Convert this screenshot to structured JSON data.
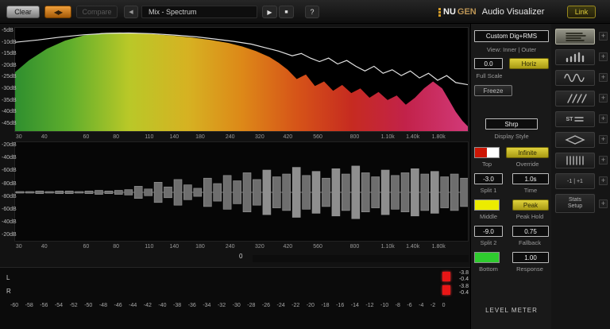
{
  "toolbar": {
    "clear": "Clear",
    "swap_icon": "◀▶",
    "compare": "Compare",
    "prev_icon": "◀",
    "preset": "Mix - Spectrum",
    "play_icon": "▶",
    "stop_icon": "■",
    "help": "?",
    "brand_nu": "NU",
    "brand_gen": "GEN",
    "brand_rest": "Audio Visualizer",
    "link": "Link"
  },
  "panel": {
    "mode": "Custom Dig+RMS",
    "view_label": "View: Inner | Outer",
    "full_scale_value": "0.0",
    "horiz": "Horiz",
    "full_scale_label": "Full Scale",
    "freeze": "Freeze",
    "display_style_value": "Shrp",
    "display_style_label": "Display Style",
    "top_label": "Top",
    "override_value": "Infinite",
    "override_label": "Override",
    "split1_value": "-3.0",
    "split1_label": "Split 1",
    "time_value": "1.0s",
    "time_label": "Time",
    "middle_label": "Middle",
    "peak_value": "Peak",
    "peak_hold_label": "Peak Hold",
    "split2_value": "-9.0",
    "split2_label": "Split 2",
    "fallback_value": "0.75",
    "fallback_label": "Fallback",
    "bottom_label": "Bottom",
    "response_value": "1.00",
    "response_label": "Response",
    "level_meter_label": "LEVEL METER",
    "colors": {
      "top_left": "#cc1605",
      "top_right": "#ffffff",
      "middle": "#ecec00",
      "bottom": "#2fcc2f",
      "accent_yellow": "#d8c623"
    }
  },
  "sidebar": {
    "plus": "+",
    "items": [
      {
        "name": "spectrum-lines",
        "selected": true
      },
      {
        "name": "bar-graph",
        "selected": false
      },
      {
        "name": "waveform",
        "selected": false
      },
      {
        "name": "diagonal-lines",
        "selected": false
      },
      {
        "name": "stereo",
        "selected": false,
        "label": "ST"
      },
      {
        "name": "vectorscope",
        "selected": false
      },
      {
        "name": "vertical-bars",
        "selected": false
      },
      {
        "name": "channel-select",
        "selected": false,
        "label": "-1 | +1"
      },
      {
        "name": "stats-setup",
        "selected": false,
        "label_1": "Stats",
        "label_2": "Setup"
      }
    ]
  },
  "width_meter": {
    "zero_label": "0",
    "segments": 54,
    "lit": 54,
    "color": "#2ed22e"
  },
  "chart_data": [
    {
      "type": "area",
      "title": "Main spectrum display (Mix - Spectrum)",
      "ylabel": "dB",
      "ylim": [
        -48,
        -3
      ],
      "grid": false,
      "y_ticks": [
        "-5dB",
        "-10dB",
        "-15dB",
        "-20dB",
        "-25dB",
        "-30dB",
        "-35dB",
        "-40dB",
        "-45dB"
      ],
      "x_ticks": [
        {
          "label": "30",
          "pos": 0.01
        },
        {
          "label": "40",
          "pos": 0.066
        },
        {
          "label": "60",
          "pos": 0.158
        },
        {
          "label": "80",
          "pos": 0.224
        },
        {
          "label": "110",
          "pos": 0.297
        },
        {
          "label": "140",
          "pos": 0.352
        },
        {
          "label": "180",
          "pos": 0.409
        },
        {
          "label": "240",
          "pos": 0.475
        },
        {
          "label": "320",
          "pos": 0.54
        },
        {
          "label": "420",
          "pos": 0.602
        },
        {
          "label": "560",
          "pos": 0.668
        },
        {
          "label": "800",
          "pos": 0.749
        },
        {
          "label": "1.10k",
          "pos": 0.822
        },
        {
          "label": "1.40k",
          "pos": 0.877
        },
        {
          "label": "1.80k",
          "pos": 0.934
        }
      ],
      "series": [
        {
          "name": "spectrum-fill",
          "points": [
            [
              0,
              -22
            ],
            [
              0.03,
              -17
            ],
            [
              0.07,
              -12
            ],
            [
              0.11,
              -8.5
            ],
            [
              0.15,
              -6.3
            ],
            [
              0.19,
              -5.2
            ],
            [
              0.23,
              -5
            ],
            [
              0.27,
              -5.2
            ],
            [
              0.31,
              -5.8
            ],
            [
              0.35,
              -6.4
            ],
            [
              0.39,
              -7.2
            ],
            [
              0.43,
              -8.2
            ],
            [
              0.47,
              -9.5
            ],
            [
              0.5,
              -11
            ],
            [
              0.53,
              -13
            ],
            [
              0.56,
              -15.5
            ],
            [
              0.58,
              -18
            ],
            [
              0.6,
              -21
            ],
            [
              0.62,
              -25
            ],
            [
              0.64,
              -23
            ],
            [
              0.66,
              -28
            ],
            [
              0.68,
              -26
            ],
            [
              0.7,
              -30
            ],
            [
              0.72,
              -27.5
            ],
            [
              0.74,
              -31
            ],
            [
              0.76,
              -29
            ],
            [
              0.78,
              -33
            ],
            [
              0.8,
              -30.5
            ],
            [
              0.82,
              -34
            ],
            [
              0.84,
              -32
            ],
            [
              0.86,
              -36
            ],
            [
              0.88,
              -33
            ],
            [
              0.9,
              -29
            ],
            [
              0.92,
              -26
            ],
            [
              0.94,
              -29
            ],
            [
              0.955,
              -34
            ],
            [
              0.97,
              -39
            ],
            [
              0.985,
              -43
            ],
            [
              1,
              -46
            ]
          ]
        },
        {
          "name": "average-line",
          "points": [
            [
              0,
              -9.2
            ],
            [
              0.05,
              -8.2
            ],
            [
              0.1,
              -7
            ],
            [
              0.15,
              -6
            ],
            [
              0.2,
              -5.4
            ],
            [
              0.25,
              -5.2
            ],
            [
              0.3,
              -5.5
            ],
            [
              0.35,
              -6.1
            ],
            [
              0.4,
              -6.9
            ],
            [
              0.44,
              -7.8
            ],
            [
              0.48,
              -8.8
            ],
            [
              0.52,
              -10
            ],
            [
              0.55,
              -11.5
            ],
            [
              0.58,
              -13
            ],
            [
              0.61,
              -15
            ],
            [
              0.63,
              -14
            ],
            [
              0.65,
              -16
            ],
            [
              0.67,
              -17.5
            ],
            [
              0.69,
              -16
            ],
            [
              0.71,
              -18.5
            ],
            [
              0.73,
              -17
            ],
            [
              0.75,
              -19.5
            ],
            [
              0.77,
              -21.5
            ],
            [
              0.79,
              -19.5
            ],
            [
              0.81,
              -22.5
            ],
            [
              0.83,
              -21
            ],
            [
              0.85,
              -23.5
            ],
            [
              0.87,
              -21.5
            ],
            [
              0.89,
              -24.5
            ],
            [
              0.91,
              -22.5
            ],
            [
              0.93,
              -25.5
            ],
            [
              0.95,
              -23.5
            ],
            [
              0.97,
              -26.5
            ],
            [
              1,
              -27.5
            ]
          ]
        }
      ],
      "palette": [
        {
          "off": 0,
          "color": "#2f8f2f"
        },
        {
          "off": 0.12,
          "color": "#5fae2c"
        },
        {
          "off": 0.25,
          "color": "#b9c828"
        },
        {
          "off": 0.38,
          "color": "#d6b222"
        },
        {
          "off": 0.5,
          "color": "#dd8818"
        },
        {
          "off": 0.62,
          "color": "#d65418"
        },
        {
          "off": 0.74,
          "color": "#c62b20"
        },
        {
          "off": 0.86,
          "color": "#c2224a"
        },
        {
          "off": 1,
          "color": "#d23a7a"
        }
      ],
      "line_color": "#e2e2e2"
    },
    {
      "type": "bar",
      "title": "Split spectrum display (mirrored bars)",
      "mirrored": true,
      "grid": false,
      "y_ticks": [
        "-20dB",
        "-40dB",
        "-60dB",
        "-80dB",
        "-80dB",
        "-60dB",
        "-40dB",
        "-20dB"
      ],
      "values": [
        1,
        1,
        2,
        1,
        2,
        2,
        1,
        2,
        3,
        2,
        3,
        4,
        9,
        5,
        15,
        8,
        19,
        11,
        6,
        21,
        13,
        25,
        17,
        29,
        19,
        33,
        23,
        27,
        37,
        25,
        31,
        21,
        35,
        27,
        39,
        29,
        23,
        33,
        25,
        29,
        35,
        27,
        31,
        23,
        27,
        21
      ],
      "bar_color": "#6e6e6e",
      "bar_color_bright": "#8e8e8e"
    },
    {
      "type": "meter",
      "title": "Level meter",
      "range": [
        -60,
        0
      ],
      "channels": [
        {
          "label": "L",
          "readouts": [
            "-3.8",
            "-0.4"
          ],
          "values": [
            -3.8,
            -0.4
          ]
        },
        {
          "label": "R",
          "readouts": [
            "-3.8",
            "-0.4"
          ],
          "values": [
            -3.8,
            -0.4
          ]
        }
      ],
      "scale_labels": [
        "-60",
        "-58",
        "-56",
        "-54",
        "-52",
        "-50",
        "-48",
        "-46",
        "-44",
        "-42",
        "-40",
        "-38",
        "-36",
        "-34",
        "-32",
        "-30",
        "-28",
        "-26",
        "-24",
        "-22",
        "-20",
        "-18",
        "-16",
        "-14",
        "-12",
        "-10",
        "-8",
        "-6",
        "-4",
        "-2",
        "0"
      ],
      "zones": {
        "green_to": -9.5,
        "yellow_to": -3.0
      },
      "zone_colors": {
        "green": "#1fc91f",
        "yellow": "#e3e300",
        "red": "#e32222"
      },
      "clip_indicator": true
    }
  ]
}
